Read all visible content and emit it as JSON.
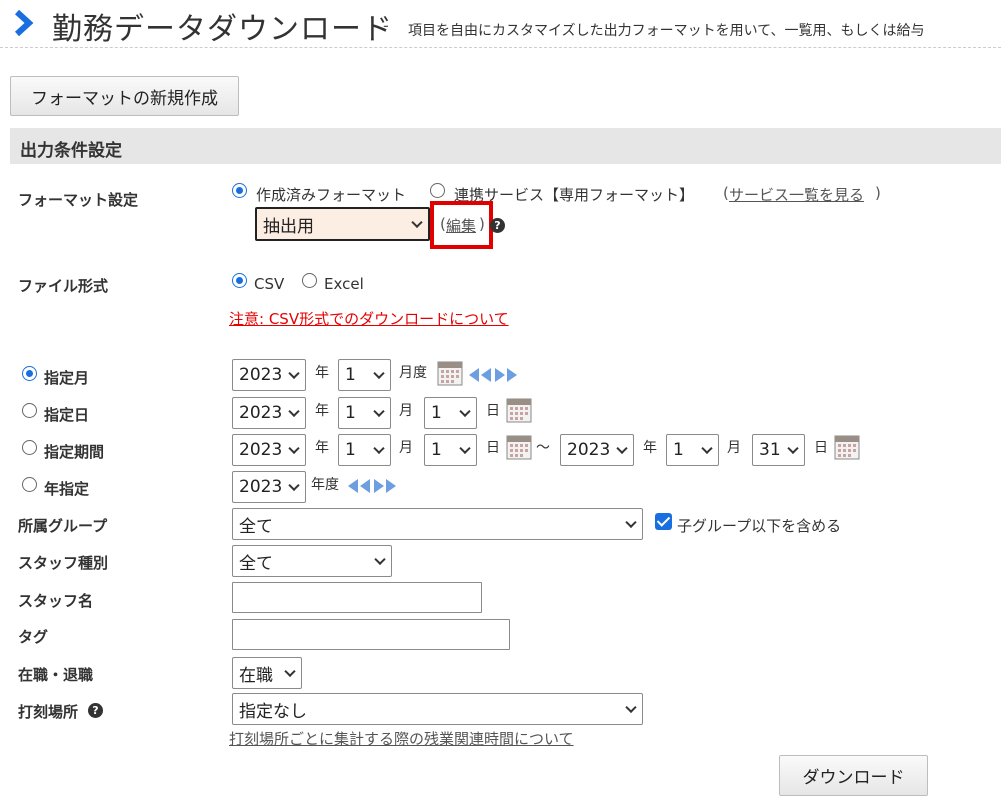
{
  "header": {
    "title": "勤務データダウンロード",
    "dash": "-",
    "description": "項目を自由にカスタマイズした出力フォーマットを用いて、一覧用、もしくは給与"
  },
  "new_format_button": "フォーマットの新規作成",
  "section_title": "出力条件設定",
  "format_setting": {
    "label": "フォーマット設定",
    "radio_created": "作成済みフォーマット",
    "radio_service": "連携サービス【専用フォーマット】",
    "service_list_open": "(",
    "service_list_link": "サービス一覧を見る",
    "service_list_close": ")",
    "selected_format": "抽出用",
    "edit_open": "(",
    "edit_link": "編集",
    "edit_close": ")"
  },
  "file_format": {
    "label": "ファイル形式",
    "csv": "CSV",
    "excel": "Excel",
    "notice_link": "注意: CSV形式でのダウンロードについて"
  },
  "period": {
    "monthly": {
      "label": "指定月",
      "year": "2023",
      "year_unit": "年",
      "month": "1",
      "month_unit": "月度"
    },
    "daily": {
      "label": "指定日",
      "year": "2023",
      "year_unit": "年",
      "month": "1",
      "month_unit": "月",
      "day": "1",
      "day_unit": "日"
    },
    "range": {
      "label": "指定期間",
      "from_year": "2023",
      "from_month": "1",
      "from_day": "1",
      "tilde": "〜",
      "to_year": "2023",
      "to_month": "1",
      "to_day": "31",
      "year_unit": "年",
      "month_unit": "月",
      "day_unit": "日"
    },
    "yearly": {
      "label": "年指定",
      "year": "2023",
      "year_unit": "年度"
    }
  },
  "group": {
    "label": "所属グループ",
    "value": "全て",
    "include_sub": "子グループ以下を含める"
  },
  "staff_type": {
    "label": "スタッフ種別",
    "value": "全て"
  },
  "staff_name": {
    "label": "スタッフ名",
    "value": ""
  },
  "tag": {
    "label": "タグ",
    "value": ""
  },
  "employment": {
    "label": "在職・退職",
    "value": "在職"
  },
  "stamp_place": {
    "label": "打刻場所",
    "value": "指定なし",
    "link": "打刻場所ごとに集計する際の残業関連時間について"
  },
  "download_button": "ダウンロード",
  "colors": {
    "accent": "#1a6fe0",
    "highlight_box": "#e00000",
    "warning_link": "#e60000",
    "section_bg": "#e6e6e6"
  }
}
